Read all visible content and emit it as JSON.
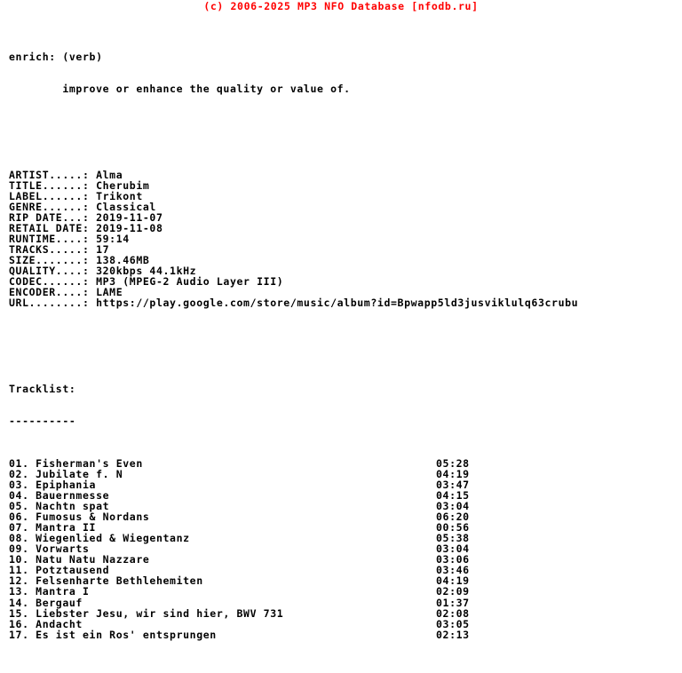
{
  "header": {
    "copyright": "(c) 2006-2025 MP3 NFO Database [nfodb.ru]",
    "color": "#ff0000"
  },
  "definition": {
    "term": "enrich: (verb)",
    "meaning": "        improve or enhance the quality or value of."
  },
  "info": {
    "fields": [
      {
        "label": "ARTIST",
        "dots": ".....",
        "sep": ": ",
        "value": "Alma"
      },
      {
        "label": "TITLE",
        "dots": "......",
        "sep": ": ",
        "value": "Cherubim"
      },
      {
        "label": "LABEL",
        "dots": "......",
        "sep": ": ",
        "value": "Trikont"
      },
      {
        "label": "GENRE",
        "dots": "......",
        "sep": ": ",
        "value": "Classical"
      },
      {
        "label": "RIP DATE",
        "dots": "...",
        "sep": ": ",
        "value": "2019-11-07"
      },
      {
        "label": "RETAIL DATE",
        "dots": "",
        "sep": ": ",
        "value": "2019-11-08"
      },
      {
        "label": "RUNTIME",
        "dots": "....",
        "sep": ": ",
        "value": "59:14"
      },
      {
        "label": "TRACKS",
        "dots": ".....",
        "sep": ": ",
        "value": "17"
      },
      {
        "label": "SIZE",
        "dots": ".......",
        "sep": ": ",
        "value": "138.46MB"
      },
      {
        "label": "QUALITY",
        "dots": "....",
        "sep": ": ",
        "value": "320kbps 44.1kHz"
      },
      {
        "label": "CODEC",
        "dots": "......",
        "sep": ": ",
        "value": "MP3 (MPEG-2 Audio Layer III)"
      },
      {
        "label": "ENCODER",
        "dots": "....",
        "sep": ": ",
        "value": "LAME"
      },
      {
        "label": "URL",
        "dots": "........",
        "sep": ": ",
        "value": "https://play.google.com/store/music/album?id=Bpwapp5ld3jusviklulq63crubu"
      }
    ],
    "lines": [
      "ARTIST.....: Alma",
      "TITLE......: Cherubim",
      "LABEL......: Trikont",
      "GENRE......: Classical",
      "RIP DATE...: 2019-11-07",
      "RETAIL DATE: 2019-11-08",
      "RUNTIME....: 59:14",
      "TRACKS.....: 17",
      "SIZE.......: 138.46MB",
      "QUALITY....: 320kbps 44.1kHz",
      "CODEC......: MP3 (MPEG-2 Audio Layer III)",
      "ENCODER....: LAME",
      "URL........: https://play.google.com/store/music/album?id=Bpwapp5ld3jusviklulq63crubu"
    ]
  },
  "tracklist": {
    "heading": "Tracklist:",
    "underline": "----------",
    "tracks": [
      {
        "name": "01. Fisherman's Even",
        "time": "05:28"
      },
      {
        "name": "02. Jubilate f. N",
        "time": "04:19"
      },
      {
        "name": "03. Epiphania",
        "time": "03:47"
      },
      {
        "name": "04. Bauernmesse",
        "time": "04:15"
      },
      {
        "name": "05. Nachtn spat",
        "time": "03:04"
      },
      {
        "name": "06. Fumosus & Nordans",
        "time": "06:20"
      },
      {
        "name": "07. Mantra II",
        "time": "00:56"
      },
      {
        "name": "08. Wiegenlied & Wiegentanz",
        "time": "05:38"
      },
      {
        "name": "09. Vorwarts",
        "time": "03:04"
      },
      {
        "name": "10. Natu Natu Nazzare",
        "time": "03:06"
      },
      {
        "name": "11. Potztausend",
        "time": "03:46"
      },
      {
        "name": "12. Felsenharte Bethlehemiten",
        "time": "04:19"
      },
      {
        "name": "13. Mantra I",
        "time": "02:09"
      },
      {
        "name": "14. Bergauf",
        "time": "01:37"
      },
      {
        "name": "15. Liebster Jesu, wir sind hier, BWV 731",
        "time": "02:08"
      },
      {
        "name": "16. Andacht",
        "time": "03:05"
      },
      {
        "name": "17. Es ist ein Ros' entsprungen",
        "time": "02:13"
      }
    ]
  }
}
